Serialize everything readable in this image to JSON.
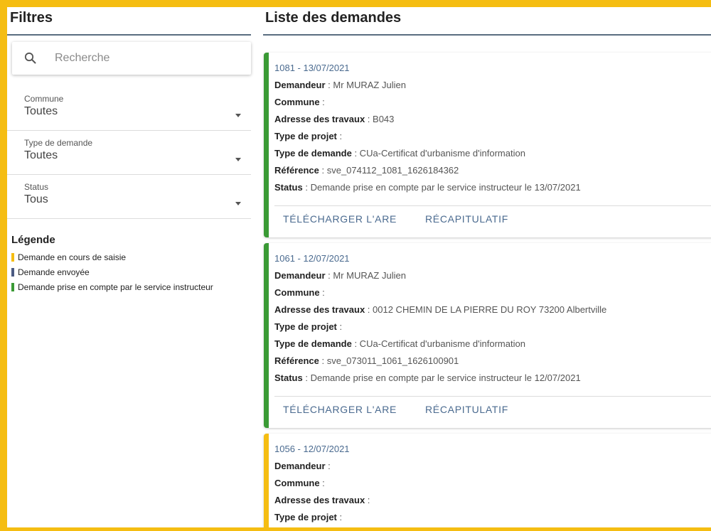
{
  "filters": {
    "title": "Filtres",
    "search_placeholder": "Recherche",
    "items": [
      {
        "label": "Commune",
        "value": "Toutes"
      },
      {
        "label": "Type de demande",
        "value": "Toutes"
      },
      {
        "label": "Status",
        "value": "Tous"
      }
    ]
  },
  "legend": {
    "title": "Légende",
    "items": [
      {
        "label": "Demande en cours de saisie",
        "color": "#f5bd12"
      },
      {
        "label": "Demande envoyée",
        "color": "#4b5b82"
      },
      {
        "label": "Demande prise en compte par le service instructeur",
        "color": "#3a9a35"
      }
    ]
  },
  "list": {
    "title": "Liste des demandes",
    "field_labels": {
      "demandeur": "Demandeur",
      "commune": "Commune",
      "adresse": "Adresse des travaux",
      "type_projet": "Type de projet",
      "type_demande": "Type de demande",
      "reference": "Référence",
      "status": "Status"
    },
    "actions": {
      "download": "Télécharger l'ARE",
      "summary": "Récapitulatif"
    },
    "cards": [
      {
        "header": "1081 - 13/07/2021",
        "status_color": "#3a9a35",
        "demandeur": " : Mr MURAZ Julien",
        "commune": " :",
        "adresse": " : B043",
        "type_projet": " :",
        "type_demande": " : CUa-Certificat d'urbanisme d'information",
        "reference": " : sve_074112_1081_1626184362",
        "status": " : Demande prise en compte par le service instructeur le 13/07/2021"
      },
      {
        "header": "1061 - 12/07/2021",
        "status_color": "#3a9a35",
        "demandeur": " : Mr MURAZ Julien",
        "commune": " :",
        "adresse": " : 0012 CHEMIN DE LA PIERRE DU ROY 73200 Albertville",
        "type_projet": " :",
        "type_demande": " : CUa-Certificat d'urbanisme d'information",
        "reference": " : sve_073011_1061_1626100901",
        "status": " : Demande prise en compte par le service instructeur le 12/07/2021"
      },
      {
        "header": "1056 - 12/07/2021",
        "status_color": "#f5bd12",
        "demandeur": " :",
        "commune": " :",
        "adresse": " :",
        "type_projet": " :"
      }
    ]
  }
}
